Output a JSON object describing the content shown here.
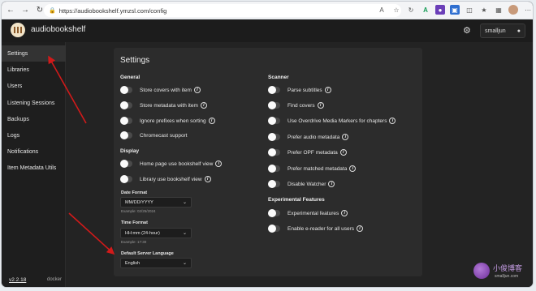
{
  "browser": {
    "url": "https://audiobookshelf.ymzsl.com/config",
    "icons": [
      "back-icon",
      "forward-icon",
      "refresh-icon",
      "home-icon",
      "lock-icon",
      "translate-icon",
      "star-icon",
      "refresh-icon",
      "extension-a-icon",
      "extension-purple-icon",
      "extension-blue-icon",
      "split-icon",
      "favorites-icon",
      "collections-icon",
      "profile-avatar"
    ]
  },
  "app": {
    "title": "audiobookshelf",
    "username": "smalljun"
  },
  "sidebar": {
    "items": [
      {
        "label": "Settings",
        "active": true
      },
      {
        "label": "Libraries",
        "active": false
      },
      {
        "label": "Users",
        "active": false
      },
      {
        "label": "Listening Sessions",
        "active": false
      },
      {
        "label": "Backups",
        "active": false
      },
      {
        "label": "Logs",
        "active": false
      },
      {
        "label": "Notifications",
        "active": false
      },
      {
        "label": "Item Metadata Utils",
        "active": false
      }
    ],
    "version": "v2.2.18",
    "docker": "docker"
  },
  "settings": {
    "title": "Settings",
    "general": {
      "heading": "General",
      "items": [
        {
          "label": "Store covers with item",
          "on": false
        },
        {
          "label": "Store metadata with item",
          "on": false
        },
        {
          "label": "Ignore prefixes when sorting",
          "on": false
        },
        {
          "label": "Chromecast support",
          "on": false
        }
      ]
    },
    "display": {
      "heading": "Display",
      "items": [
        {
          "label": "Home page use bookshelf view",
          "on": false
        },
        {
          "label": "Library use bookshelf view",
          "on": false
        }
      ],
      "date_format": {
        "label": "Date Format",
        "value": "MM/DD/YYYY",
        "example": "Example: 02/25/2024"
      },
      "time_format": {
        "label": "Time Format",
        "value": "HH:mm (24-hour)",
        "example": "Example: 17:30"
      },
      "language": {
        "label": "Default Server Language",
        "value": "English"
      }
    },
    "scanner": {
      "heading": "Scanner",
      "items": [
        {
          "label": "Parse subtitles",
          "on": false
        },
        {
          "label": "Find covers",
          "on": false
        },
        {
          "label": "Use Overdrive Media Markers for chapters",
          "on": false
        },
        {
          "label": "Prefer audio metadata",
          "on": false
        },
        {
          "label": "Prefer OPF metadata",
          "on": false
        },
        {
          "label": "Prefer matched metadata",
          "on": false
        },
        {
          "label": "Disable Watcher",
          "on": false
        }
      ]
    },
    "experimental": {
      "heading": "Experimental Features",
      "items": [
        {
          "label": "Experimental features",
          "on": false
        },
        {
          "label": "Enable e-reader for all users",
          "on": false
        }
      ]
    }
  },
  "watermark": {
    "text": "小俊博客",
    "sub": "smalljun.com"
  },
  "colors": {
    "background": "#232323",
    "sidebar_active": "#333333",
    "annotation_arrow": "#d11a1a"
  }
}
